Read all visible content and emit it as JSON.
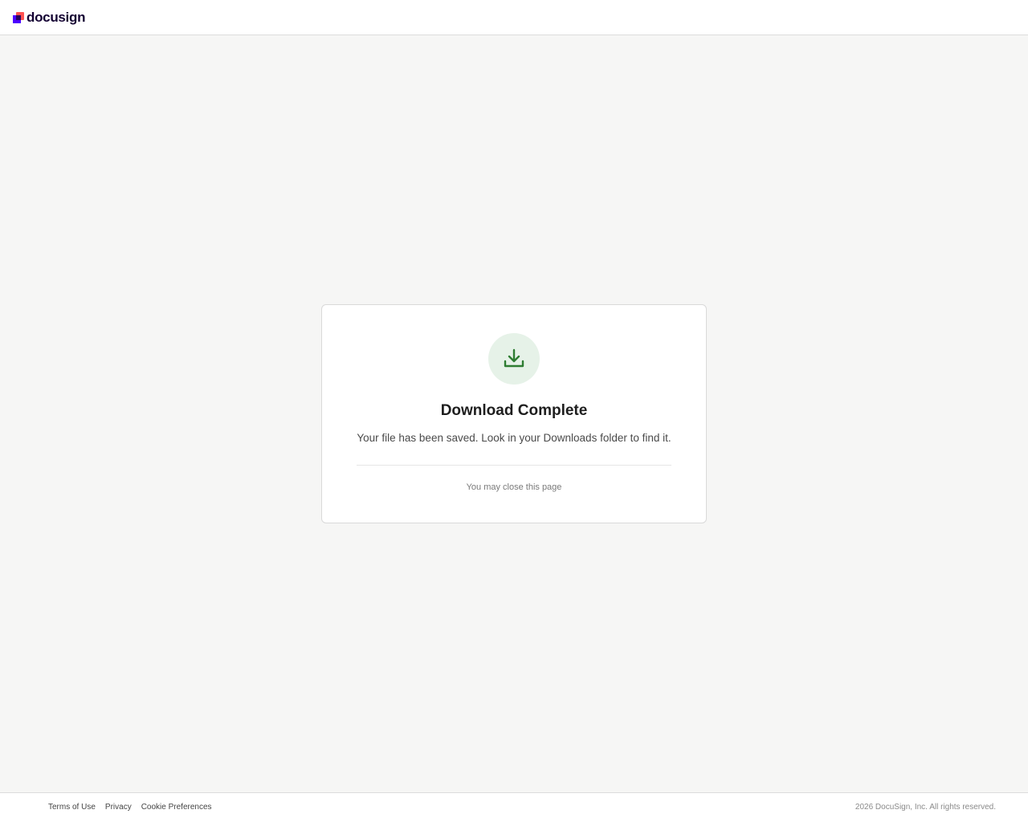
{
  "header": {
    "logo_text": "docusign"
  },
  "card": {
    "icon": "download-icon",
    "title": "Download Complete",
    "message": "Your file has been saved. Look in your Downloads folder to find it.",
    "close_note": "You may close this page"
  },
  "footer": {
    "links": [
      {
        "label": "Terms of Use"
      },
      {
        "label": "Privacy"
      },
      {
        "label": "Cookie Preferences"
      }
    ],
    "copyright": "2026 DocuSign, Inc. All rights reserved."
  },
  "colors": {
    "accent_green": "#2e7d32",
    "icon_bg": "#e6f2e8",
    "brand_purple": "#4c00ff",
    "brand_coral": "#ff5252"
  }
}
